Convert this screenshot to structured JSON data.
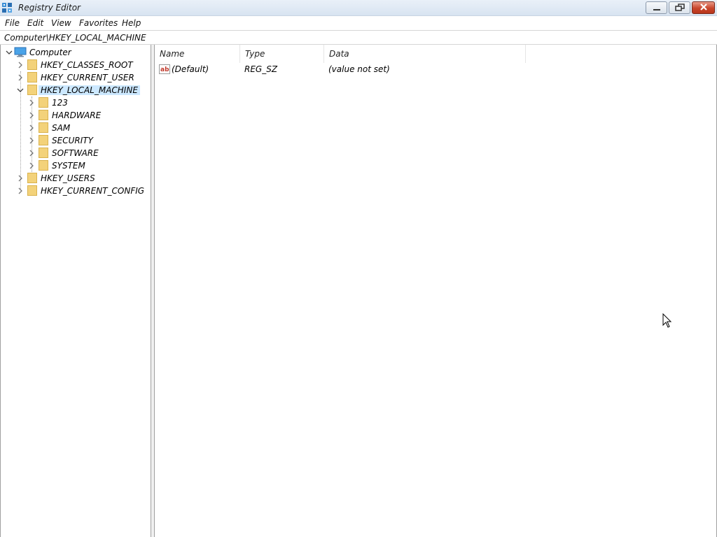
{
  "window": {
    "title": "Registry Editor",
    "app_icon": "registry-editor-icon",
    "controls": {
      "minimize": "minimize-icon",
      "restore": "restore-icon",
      "close": "close-icon"
    }
  },
  "menu": {
    "items": [
      "File",
      "Edit",
      "View",
      "Favorites",
      "Help"
    ]
  },
  "address": {
    "path": "Computer\\HKEY_LOCAL_MACHINE"
  },
  "tree": {
    "root": "Computer",
    "hives": [
      "HKEY_CLASSES_ROOT",
      "HKEY_CURRENT_USER",
      "HKEY_LOCAL_MACHINE",
      "HKEY_USERS",
      "HKEY_CURRENT_CONFIG"
    ],
    "selected": "HKEY_LOCAL_MACHINE",
    "hklm_children": [
      "123",
      "HARDWARE",
      "SAM",
      "SECURITY",
      "SOFTWARE",
      "SYSTEM"
    ]
  },
  "list": {
    "columns": [
      "Name",
      "Type",
      "Data"
    ],
    "rows": [
      {
        "name": "(Default)",
        "type": "REG_SZ",
        "data": "(value not set)",
        "icon": "string-value-icon"
      }
    ]
  },
  "colors": {
    "selection": "#cce8ff",
    "folder": "#f3d27a",
    "close_button": "#c8452b"
  }
}
